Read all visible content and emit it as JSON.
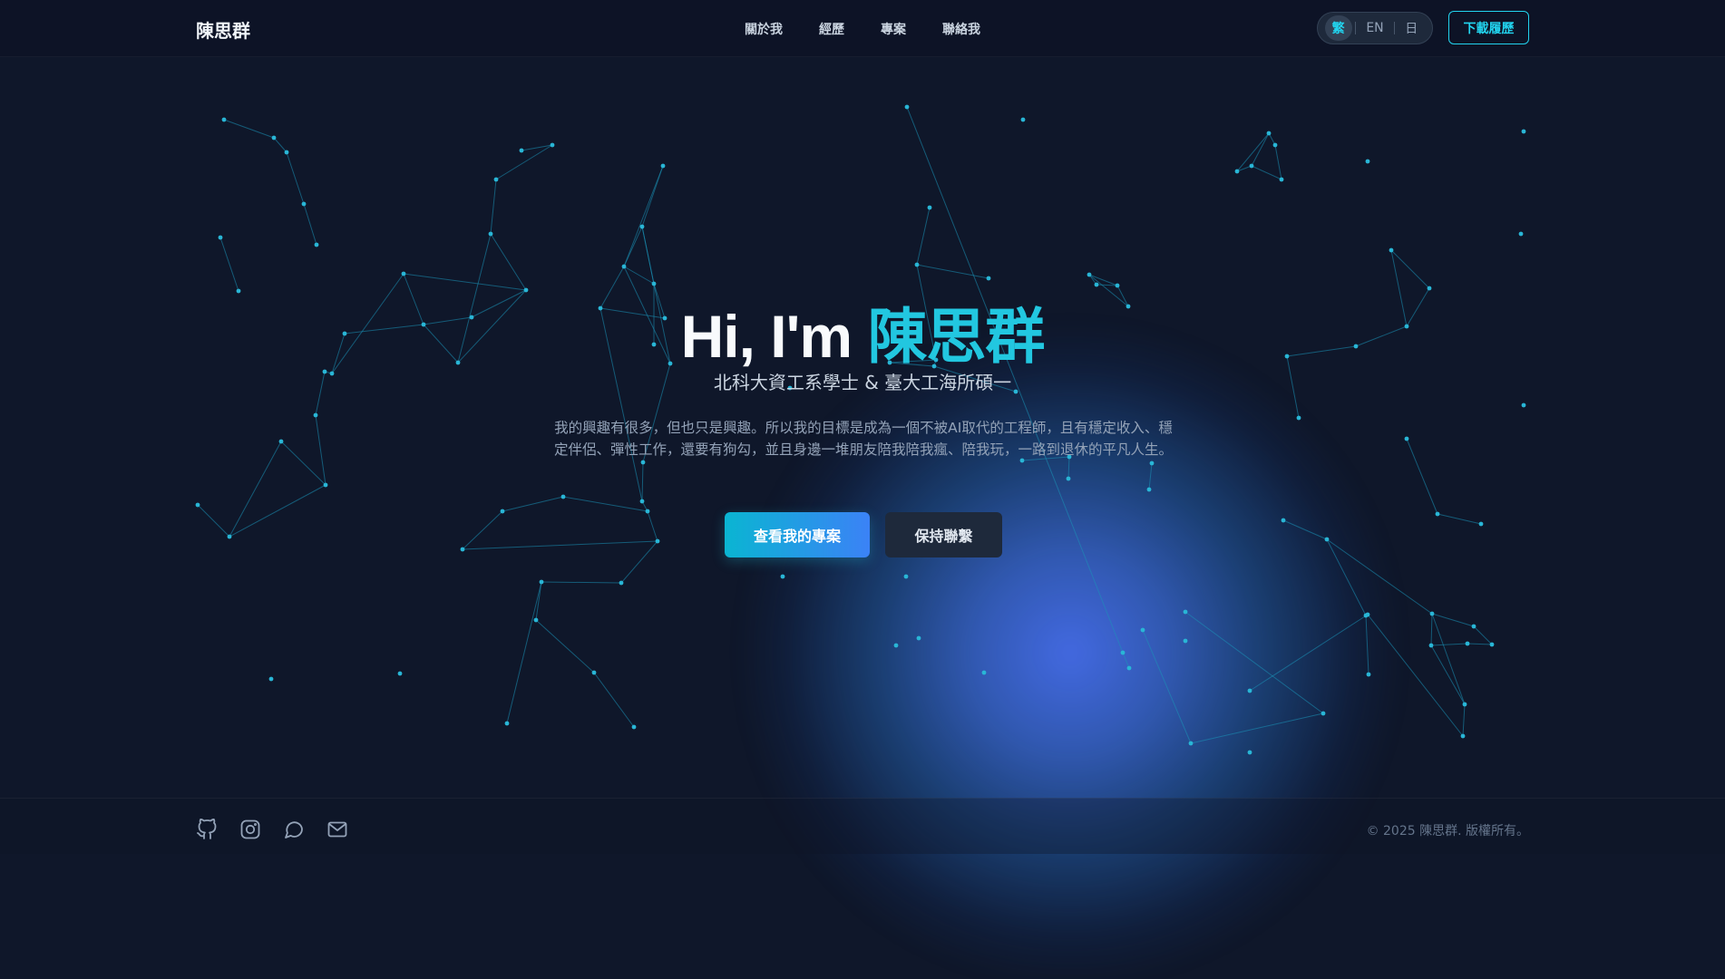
{
  "header": {
    "brand": "陳思群",
    "nav": [
      "關於我",
      "經歷",
      "專案",
      "聯絡我"
    ],
    "languages": [
      "繁",
      "EN",
      "日"
    ],
    "active_language": "繁",
    "download_cv": "下載履歷"
  },
  "hero": {
    "greeting": "Hi, I'm",
    "name": "陳思群",
    "subtitle": "北科大資工系學士 & 臺大工海所碩一",
    "description": "我的興趣有很多，但也只是興趣。所以我的目標是成為一個不被AI取代的工程師，且有穩定收入、穩定伴侶、彈性工作，還要有狗勾，並且身邊一堆朋友陪我陪我瘋、陪我玩，一路到退休的平凡人生。",
    "primary_button": "查看我的專案",
    "secondary_button": "保持聯繫"
  },
  "footer": {
    "social_icons": [
      "github-icon",
      "instagram-icon",
      "chat-icon",
      "mail-icon"
    ],
    "copyright": "© 2025 陳思群. 版權所有。"
  },
  "colors": {
    "background": "#0f172a",
    "accent": "#22d3ee",
    "gradient_end": "#3b82f6"
  }
}
